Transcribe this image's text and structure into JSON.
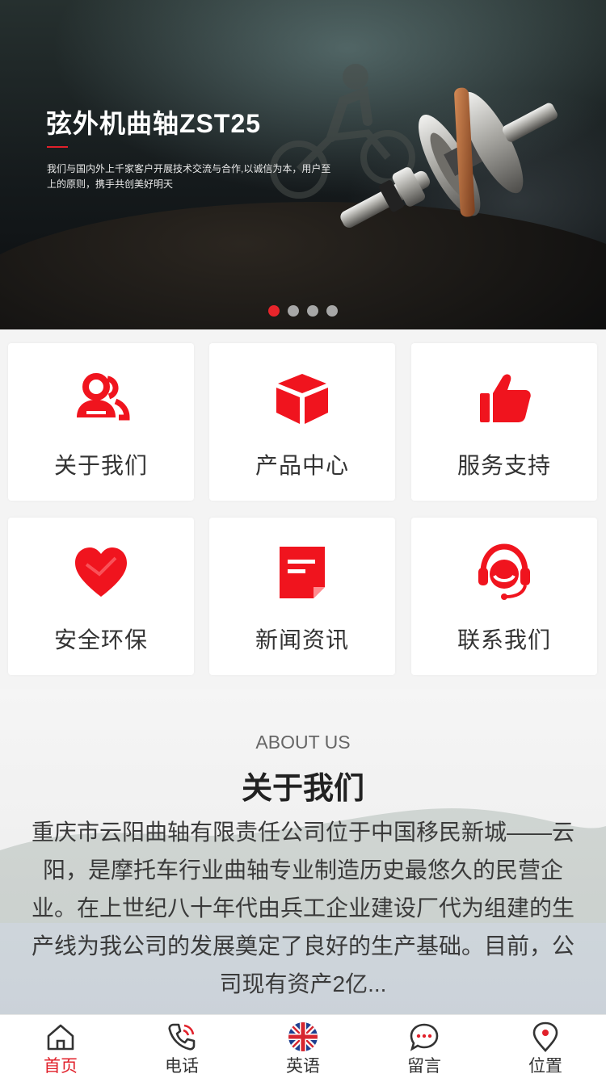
{
  "banner": {
    "title": "弦外机曲轴ZST25",
    "description": "我们与国内外上千家客户开展技术交流与合作,以诚信为本，用户至上的原则，携手共创美好明天",
    "slide_count": 4,
    "active_slide": 1
  },
  "colors": {
    "accent": "#e8252b",
    "icon_red": "#f0141e"
  },
  "grid": {
    "items": [
      {
        "label": "关于我们",
        "icon": "users-icon"
      },
      {
        "label": "产品中心",
        "icon": "box-icon"
      },
      {
        "label": "服务支持",
        "icon": "thumbs-up-icon"
      },
      {
        "label": "安全环保",
        "icon": "heart-icon"
      },
      {
        "label": "新闻资讯",
        "icon": "note-icon"
      },
      {
        "label": "联系我们",
        "icon": "headset-icon"
      }
    ]
  },
  "about": {
    "subtitle_en": "ABOUT US",
    "title": "关于我们",
    "text": "重庆市云阳曲轴有限责任公司位于中国移民新城——云阳，是摩托车行业曲轴专业制造历史最悠久的民营企业。在上世纪八十年代由兵工企业建设厂代为组建的生产线为我公司的发展奠定了良好的生产基础。目前，公司现有资产2亿..."
  },
  "tabbar": {
    "items": [
      {
        "label": "首页",
        "icon": "home-icon",
        "active": true
      },
      {
        "label": "电话",
        "icon": "phone-icon",
        "active": false
      },
      {
        "label": "英语",
        "icon": "uk-flag-icon",
        "active": false
      },
      {
        "label": "留言",
        "icon": "message-icon",
        "active": false
      },
      {
        "label": "位置",
        "icon": "location-icon",
        "active": false
      }
    ]
  }
}
